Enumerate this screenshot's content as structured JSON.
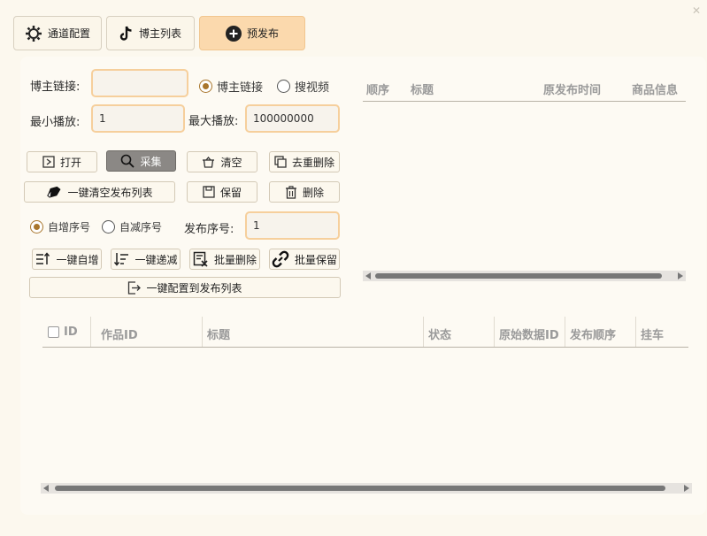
{
  "topbar": {
    "channel_config": "通道配置",
    "blogger_list": "博主列表",
    "pre_publish": "预发布"
  },
  "form": {
    "blogger_link_label": "博主链接:",
    "blogger_link_value": "",
    "radio_blogger_link": "博主链接",
    "radio_search_video": "搜视频",
    "min_play_label": "最小播放:",
    "min_play_value": "1",
    "max_play_label": "最大播放:",
    "max_play_value": "100000000",
    "publish_seq_label": "发布序号:",
    "publish_seq_value": "1",
    "radio_auto_inc": "自增序号",
    "radio_auto_dec": "自减序号"
  },
  "buttons": {
    "open": "打开",
    "collect": "采集",
    "clear": "清空",
    "dedupe_delete": "去重删除",
    "clear_publish_list": "一键清空发布列表",
    "keep": "保留",
    "delete": "删除",
    "one_key_inc": "一键自增",
    "one_key_dec": "一键递减",
    "batch_delete": "批量删除",
    "batch_keep": "批量保留",
    "config_to_publish": "一键配置到发布列表"
  },
  "right_table": {
    "columns": [
      "顺序",
      "标题",
      "原发布时间",
      "商品信息"
    ]
  },
  "bottom_table": {
    "columns": [
      "ID",
      "作品ID",
      "标题",
      "状态",
      "原始数据ID",
      "发布顺序",
      "挂车"
    ]
  },
  "colors": {
    "background": "#fcf8ee",
    "accent": "#fbd9ad",
    "input_border": "#f6cf9c",
    "radio_selected": "#a9762d"
  }
}
